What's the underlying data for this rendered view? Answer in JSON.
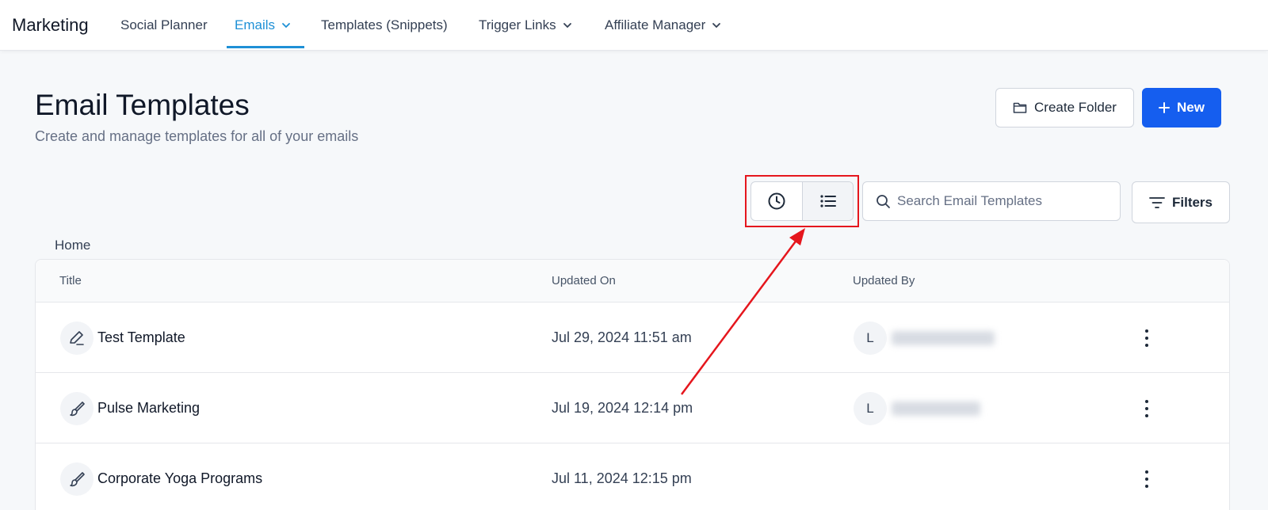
{
  "nav": {
    "brand": "Marketing",
    "items": [
      {
        "label": "Social Planner",
        "has_dropdown": false,
        "active": false
      },
      {
        "label": "Emails",
        "has_dropdown": true,
        "active": true
      },
      {
        "label": "Templates (Snippets)",
        "has_dropdown": false,
        "active": false
      },
      {
        "label": "Trigger Links",
        "has_dropdown": true,
        "active": false
      },
      {
        "label": "Affiliate Manager",
        "has_dropdown": true,
        "active": false
      }
    ],
    "accent_color": "#1e90d6"
  },
  "header": {
    "title": "Email Templates",
    "subtitle": "Create and manage templates for all of your emails",
    "create_folder_label": "Create Folder",
    "new_label": "New",
    "primary_color": "#155eef"
  },
  "toolbar": {
    "view_modes": [
      "clock-icon",
      "list-icon"
    ],
    "selected_view": "list-icon",
    "search_placeholder": "Search Email Templates",
    "search_value": "",
    "filters_label": "Filters",
    "highlight_color": "#e5161d"
  },
  "breadcrumb": "Home",
  "table": {
    "columns": [
      "Title",
      "Updated On",
      "Updated By"
    ],
    "rows": [
      {
        "title": "Test Template",
        "updated_on": "Jul 29, 2024 11:51 am",
        "avatar": "L",
        "icon": "pen-icon"
      },
      {
        "title": "Pulse Marketing",
        "updated_on": "Jul 19, 2024 12:14 pm",
        "avatar": "L",
        "icon": "brush-icon"
      },
      {
        "title": "Corporate Yoga Programs",
        "updated_on": "Jul 11, 2024 12:15 pm",
        "avatar": "",
        "icon": "brush-icon"
      }
    ]
  }
}
